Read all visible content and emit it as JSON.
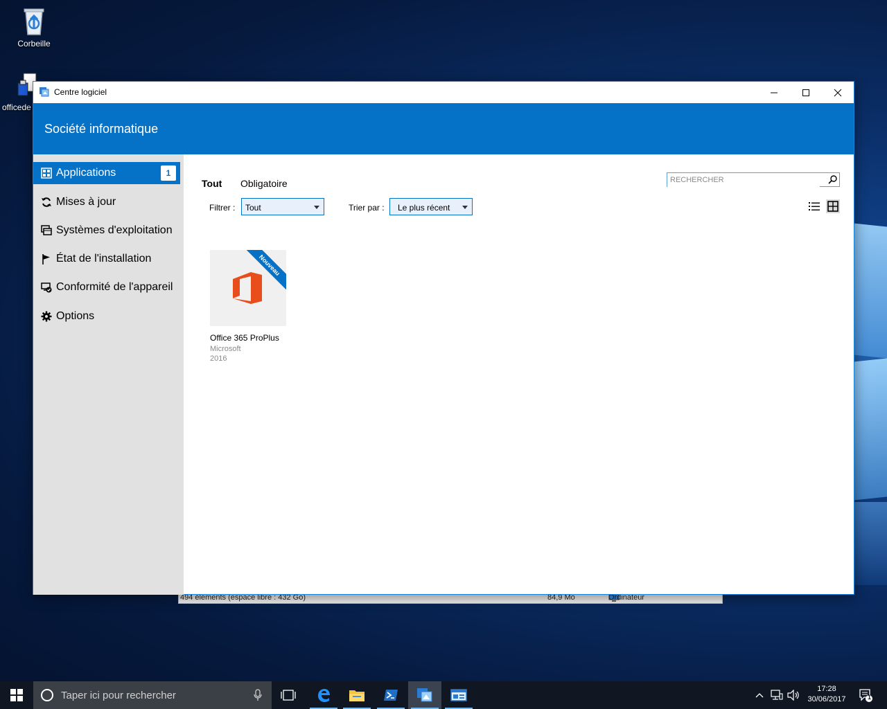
{
  "desktop": {
    "icons": [
      {
        "label": "Corbeille"
      },
      {
        "label": "officede"
      }
    ],
    "background_window": {
      "items_text": "494 éléments (espace libre : 432 Go)",
      "size_text": "84,9 Mo",
      "location_text": "Ordinateur"
    }
  },
  "window": {
    "title": "Centre logiciel",
    "org_name": "Société informatique",
    "controls": {
      "minimize": "minimize",
      "maximize": "maximize",
      "close": "close"
    }
  },
  "sidebar": {
    "items": [
      {
        "label": "Applications",
        "icon": "grid-icon",
        "badge": "1",
        "active": true
      },
      {
        "label": "Mises à jour",
        "icon": "refresh-icon"
      },
      {
        "label": "Systèmes d'exploitation",
        "icon": "windows-stack-icon"
      },
      {
        "label": "État de l'installation",
        "icon": "flag-icon"
      },
      {
        "label": "Conformité de l'appareil",
        "icon": "device-check-icon"
      },
      {
        "label": "Options",
        "icon": "gear-icon"
      }
    ]
  },
  "content": {
    "tabs": [
      {
        "label": "Tout",
        "active": true
      },
      {
        "label": "Obligatoire",
        "active": false
      }
    ],
    "search": {
      "placeholder": "RECHERCHER"
    },
    "filter": {
      "label": "Filtrer :",
      "value": "Tout"
    },
    "sort": {
      "label": "Trier par :",
      "value": "Le plus récent"
    },
    "view_modes": [
      "list-view-icon",
      "grid-view-icon"
    ],
    "apps": [
      {
        "name": "Office 365 ProPlus",
        "publisher": "Microsoft",
        "version": "2016",
        "ribbon": "Nouveau",
        "icon": "office-icon"
      }
    ]
  },
  "taskbar": {
    "search_placeholder": "Taper ici pour rechercher",
    "time": "17:28",
    "date": "30/06/2017",
    "notification_count": "1"
  },
  "colors": {
    "accent": "#0672c7",
    "sidebar_bg": "#e1e1e1",
    "office_orange": "#e84e1c",
    "taskbar_bg": "#101722"
  }
}
